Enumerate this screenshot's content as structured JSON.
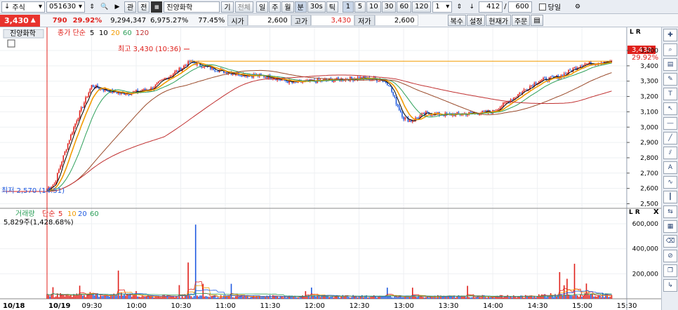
{
  "toolbar": {
    "mode": "주식",
    "code": "051630",
    "btn_gwan": "관",
    "btn_jeon": "전",
    "name": "진양화학",
    "btn_gi": "기",
    "btn_jeonche": "전체",
    "periods": [
      "일",
      "주",
      "월",
      "분",
      "30s",
      "틱"
    ],
    "intervals": [
      "1",
      "5",
      "10",
      "30",
      "60",
      "120"
    ],
    "step": "1",
    "count_cur": "412",
    "sep": "/",
    "count_max": "600",
    "today_label": "당일"
  },
  "quote": {
    "price": "3,430",
    "change": "790",
    "change_pct": "29.92%",
    "volume": "9,294,347",
    "vol_ratio": "6,975.27%",
    "strength": "77.45%",
    "open_label": "시가",
    "open": "2,600",
    "high_label": "고가",
    "high": "3,430",
    "low_label": "저가",
    "low": "2,600",
    "btns": [
      "복수",
      "설정",
      "현재가",
      "주문"
    ]
  },
  "colors": {
    "up": "#e0201b",
    "down": "#1f5ae0",
    "ma5": "#000000",
    "ma10": "#f29b00",
    "ma20": "#2ea05a",
    "ma60": "#9a4a2a",
    "ma120": "#c03030"
  },
  "price_panel": {
    "name_tag": "진양화학",
    "ma_label": "종가 단순",
    "ma_periods": [
      "5",
      "10",
      "20",
      "60",
      "120"
    ],
    "high_annot": "최고 3,430 (10:36)",
    "low_annot": "최저 2,570 (14:51)",
    "cur_price_tag": "3,430",
    "cur_pct_tag": "29.92%",
    "yticks": [
      "3,500",
      "3,400",
      "3,300",
      "3,200",
      "3,100",
      "3,000",
      "2,900",
      "2,800",
      "2,700",
      "2,600",
      "2,500"
    ]
  },
  "volume_panel": {
    "title": "거래량",
    "ma_label": "단순",
    "ma_periods": [
      "5",
      "10",
      "20",
      "60"
    ],
    "summary": "5,829주(1,428.68%)",
    "yticks": [
      "600,000",
      "400,000",
      "200,000"
    ]
  },
  "xaxis": [
    "10/18",
    "10/19",
    "09:30",
    "10:00",
    "10:30",
    "11:00",
    "11:30",
    "12:00",
    "12:30",
    "13:00",
    "13:30",
    "14:00",
    "14:30",
    "15:00",
    "15:30"
  ],
  "chart_data": {
    "type": "line",
    "x": [
      "09:00",
      "09:05",
      "09:10",
      "09:15",
      "09:20",
      "09:30",
      "09:40",
      "09:50",
      "10:00",
      "10:10",
      "10:20",
      "10:30",
      "10:36",
      "10:45",
      "11:00",
      "11:15",
      "11:30",
      "11:45",
      "12:00",
      "12:15",
      "12:30",
      "12:45",
      "12:50",
      "12:55",
      "13:00",
      "13:05",
      "13:15",
      "13:30",
      "13:45",
      "14:00",
      "14:15",
      "14:30",
      "14:45",
      "15:00",
      "15:10",
      "15:15"
    ],
    "series": [
      {
        "values": [
          2600,
          2630,
          2780,
          2920,
          3050,
          3270,
          3240,
          3220,
          3230,
          3250,
          3320,
          3380,
          3430,
          3400,
          3360,
          3340,
          3330,
          3290,
          3300,
          3310,
          3320,
          3310,
          3280,
          3160,
          3060,
          3040,
          3090,
          3080,
          3090,
          3100,
          3200,
          3300,
          3330,
          3410,
          3420,
          3430
        ]
      }
    ],
    "ylim": [
      2500,
      3500
    ],
    "annotations": [
      "최고 3,430 (10:36)",
      "최저 2,570 (14:51)"
    ],
    "volume": {
      "ylim": [
        0,
        600000
      ],
      "peaks": [
        [
          593000,
          "10:40"
        ],
        [
          280000,
          "14:55"
        ]
      ]
    }
  }
}
